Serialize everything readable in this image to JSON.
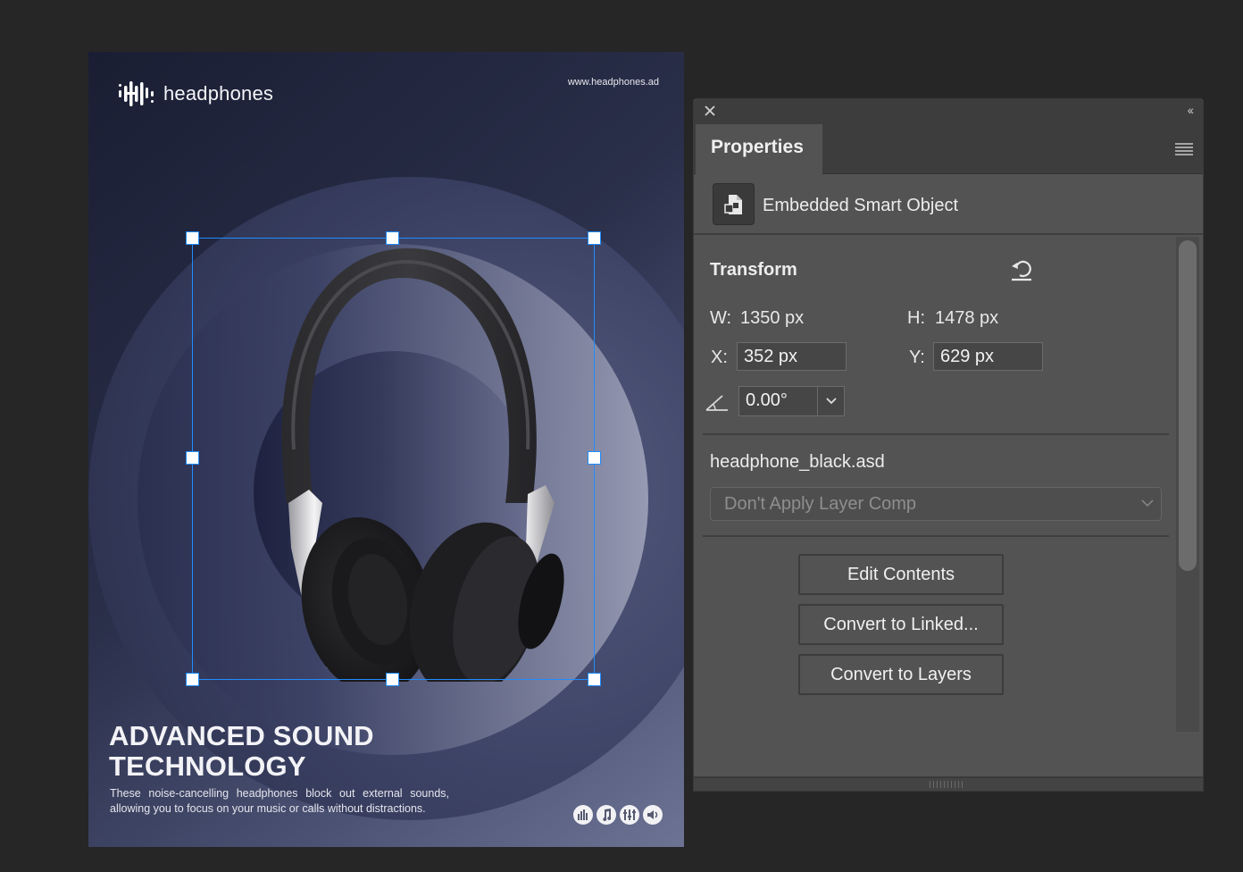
{
  "poster": {
    "brand": "headphones",
    "url": "www.headphones.ad",
    "headline_line1": "ADVANCED SOUND",
    "headline_line2": "TECHNOLOGY",
    "body": "These noise-cancelling headphones block out external sounds, allowing you to focus on your music or calls without distractions.",
    "feature_icons": [
      "equalizer-icon",
      "music-note-icon",
      "sliders-icon",
      "speaker-icon"
    ]
  },
  "panel": {
    "tab": "Properties",
    "object_type": "Embedded Smart Object",
    "transform": {
      "title": "Transform",
      "w_label": "W:",
      "w_value": "1350 px",
      "h_label": "H:",
      "h_value": "1478 px",
      "x_label": "X:",
      "x_value": "352 px",
      "y_label": "Y:",
      "y_value": "629 px",
      "angle_value": "0.00°"
    },
    "file_name": "headphone_black.asd",
    "layer_comp": "Don't Apply Layer Comp",
    "buttons": {
      "edit": "Edit Contents",
      "linked": "Convert to Linked...",
      "layers": "Convert to Layers"
    }
  },
  "colors": {
    "selection": "#1f8dff",
    "panel_bg": "#535353",
    "app_bg": "#262626"
  }
}
